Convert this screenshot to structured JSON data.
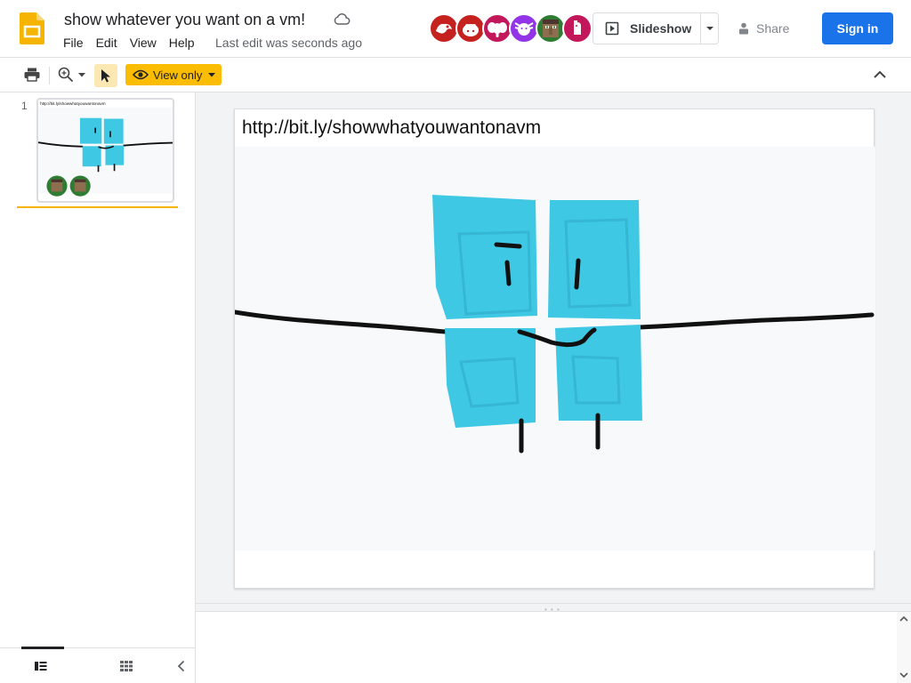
{
  "document": {
    "title": "show whatever you want on a vm!",
    "last_edit": "Last edit was seconds ago"
  },
  "menu": [
    "File",
    "Edit",
    "View",
    "Help"
  ],
  "collaborators": [
    {
      "icon": "dragon-avatar-icon",
      "color": "#c5221f"
    },
    {
      "icon": "hippo-avatar-icon",
      "color": "#c5221f"
    },
    {
      "icon": "elephant-avatar-icon",
      "color": "#c2185b"
    },
    {
      "icon": "axolotl-avatar-icon",
      "color": "#9334e6"
    },
    {
      "icon": "villager-avatar-icon",
      "color": "#2e7d32"
    },
    {
      "icon": "llama-avatar-icon",
      "color": "#c2185b"
    }
  ],
  "actions": {
    "slideshow": "Slideshow",
    "share": "Share",
    "sign_in": "Sign in"
  },
  "toolbar": {
    "view_only": "View only"
  },
  "filmstrip": {
    "slides": [
      {
        "number": "1",
        "caption": "http://bit.ly/showwhatyouwantonavm"
      }
    ]
  },
  "slide": {
    "url_text": "http://bit.ly/showwhatyouwantonavm"
  },
  "colors": {
    "accent": "#1a73e8",
    "view_only_bg": "#fbbc04",
    "window_pane": "#3ec8e4",
    "selection": "#f4b400"
  }
}
